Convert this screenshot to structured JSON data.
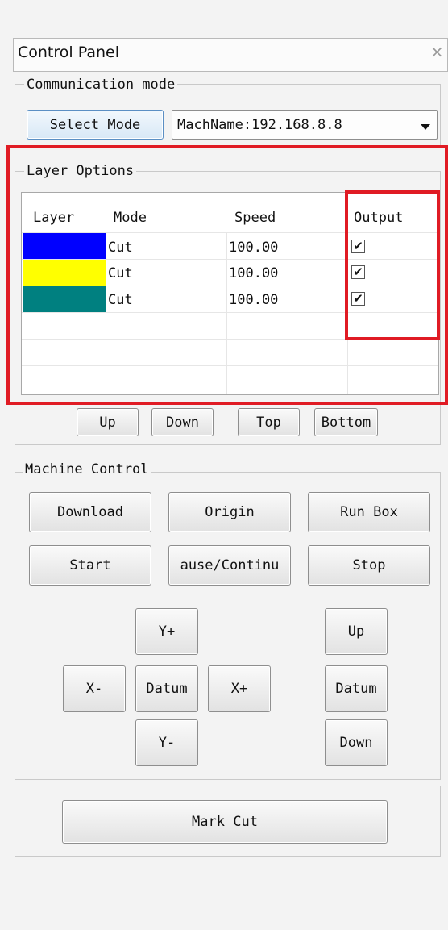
{
  "panel": {
    "title": "Control Panel",
    "close_glyph": "×"
  },
  "communication": {
    "label": "Communication mode",
    "select_button": "Select Mode",
    "machine_combo": "MachName:192.168.8.8"
  },
  "layers": {
    "label": "Layer Options",
    "columns": [
      "Layer",
      "Mode",
      "Speed",
      "Output"
    ],
    "rows": [
      {
        "color": "#0000ff",
        "mode": "Cut",
        "speed": "100.00",
        "output_checked": true
      },
      {
        "color": "#ffff00",
        "mode": "Cut",
        "speed": "100.00",
        "output_checked": true
      },
      {
        "color": "#008080",
        "mode": "Cut",
        "speed": "100.00",
        "output_checked": true
      }
    ],
    "check_glyph": "✔",
    "buttons": {
      "up": "Up",
      "down": "Down",
      "top": "Top",
      "bottom": "Bottom"
    }
  },
  "machine": {
    "label": "Machine Control",
    "download": "Download",
    "origin": "Origin",
    "run_box": "Run Box",
    "start": "Start",
    "pause": "ause/Continu",
    "stop": "Stop",
    "y_plus": "Y+",
    "x_minus": "X-",
    "datum_xy": "Datum",
    "x_plus": "X+",
    "y_minus": "Y-",
    "z_up": "Up",
    "z_datum": "Datum",
    "z_down": "Down"
  },
  "mark_cut": "Mark Cut",
  "highlight_color": "#e01b24"
}
